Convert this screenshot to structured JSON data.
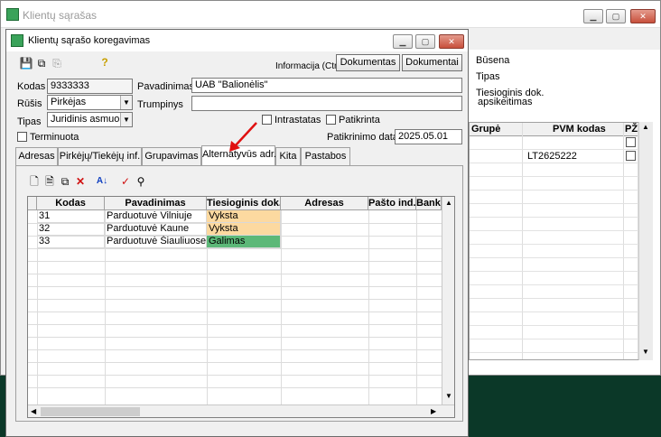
{
  "bg_window": {
    "title": "Klientų sąrašas",
    "labels": {
      "busena": "Būsena",
      "tipas": "Tipas",
      "tiesioginis_line1": "Tiesioginis dok.",
      "tiesioginis_line2": "apsikeitimas"
    },
    "grid_headers": [
      "Grupė",
      "PVM kodas",
      "PŽ"
    ],
    "grid_rows": [
      {
        "grupe": "",
        "pvm": "",
        "checked": false
      },
      {
        "grupe": "",
        "pvm": "LT2625222",
        "checked": false
      }
    ]
  },
  "dialog": {
    "title": "Klientų sąrašo koregavimas",
    "info_label": "Informacija (Ctrl+...",
    "buttons": {
      "dokumentas": "Dokumentas",
      "dokumentai": "Dokumentai"
    },
    "form": {
      "kodas_label": "Kodas",
      "kodas_value": "9333333",
      "pavadinimas_label": "Pavadinimas",
      "pavadinimas_value": "UAB \"Balionėlis\"",
      "rusis_label": "Rūšis",
      "rusis_value": "Pirkėjas",
      "trumpinys_label": "Trumpinys",
      "trumpinys_value": "",
      "tipas_label": "Tipas",
      "tipas_value": "Juridinis asmuo",
      "intrastatas_label": "Intrastatas",
      "patikrinta_label": "Patikrinta",
      "terminuota_label": "Terminuota",
      "patikrinimo_data_label": "Patikrinimo data",
      "patikrinimo_data_value": "2025.05.01"
    },
    "tabs": [
      "Adresas",
      "Pirkėjų/Tiekėjų inf.",
      "Grupavimas",
      "Alternatyvūs adr.",
      "Kita",
      "Pastabos"
    ],
    "active_tab": "Alternatyvūs adr.",
    "grid": {
      "headers": [
        "Kodas",
        "Pavadinimas",
        "Tiesioginis dok.ap",
        "Adresas",
        "Pašto ind.",
        "Banko k"
      ],
      "rows": [
        {
          "kodas": "31",
          "pavadinimas": "Parduotuvė Vilniuje",
          "tiesioginis": "Vyksta",
          "status_color": "#fcd9a0"
        },
        {
          "kodas": "32",
          "pavadinimas": "Parduotuvė  Kaune",
          "tiesioginis": "Vyksta",
          "status_color": "#fcd9a0"
        },
        {
          "kodas": "33",
          "pavadinimas": "Parduotuvė Šiauliuose",
          "tiesioginis": "Galimas",
          "status_color": "#5cb878"
        }
      ]
    }
  },
  "colors": {
    "annotation_arrow": "#e01010",
    "status_vyksta": "#fcd9a0",
    "status_galimas": "#5cb878"
  }
}
